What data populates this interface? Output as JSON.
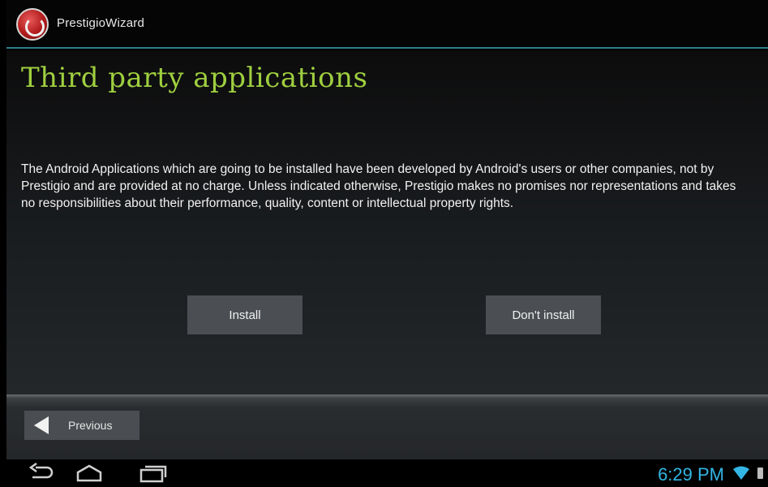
{
  "app": {
    "title": "PrestigioWizard",
    "logo_icon": "prestigio-logo-icon"
  },
  "page": {
    "heading": "Third party applications",
    "body": "The Android Applications which are going to be installed have been developed by Android's users or other companies, not by Prestigio and are provided at no charge. Unless indicated otherwise, Prestigio makes no promises nor representations and takes no responsibilities about their performance, quality, content or intellectual property rights."
  },
  "actions": {
    "install_label": "Install",
    "dont_install_label": "Don't install"
  },
  "navigation": {
    "previous_label": "Previous"
  },
  "system_bar": {
    "time": "6:29 PM",
    "icons": [
      "back-icon",
      "home-icon",
      "recent-apps-icon",
      "wifi-icon",
      "battery-icon"
    ]
  },
  "colors": {
    "heading": "#9fcf3f",
    "accent_line": "#2f7f8a",
    "clock": "#33b5e5"
  }
}
